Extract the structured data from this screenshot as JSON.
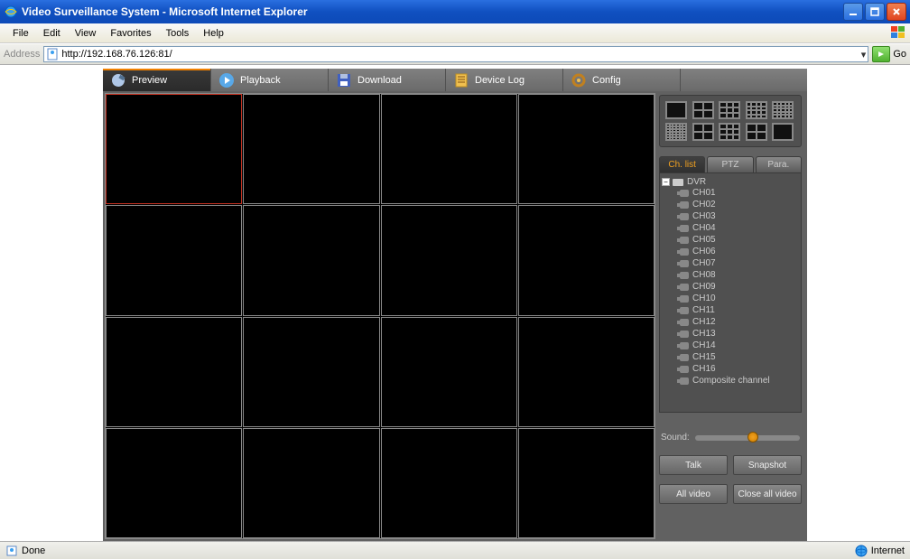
{
  "window": {
    "title": "Video Surveillance System - Microsoft Internet Explorer"
  },
  "menubar": [
    "File",
    "Edit",
    "View",
    "Favorites",
    "Tools",
    "Help"
  ],
  "addressbar": {
    "label": "Address",
    "url": "http://192.168.76.126:81/",
    "go_label": "Go"
  },
  "app_tabs": [
    {
      "label": "Preview",
      "active": true
    },
    {
      "label": "Playback",
      "active": false
    },
    {
      "label": "Download",
      "active": false
    },
    {
      "label": "Device Log",
      "active": false
    },
    {
      "label": "Config",
      "active": false
    }
  ],
  "sub_tabs": [
    {
      "label": "Ch. list",
      "active": true
    },
    {
      "label": "PTZ",
      "active": false
    },
    {
      "label": "Para.",
      "active": false
    }
  ],
  "tree": {
    "root_label": "DVR",
    "items": [
      "CH01",
      "CH02",
      "CH03",
      "CH04",
      "CH05",
      "CH06",
      "CH07",
      "CH08",
      "CH09",
      "CH10",
      "CH11",
      "CH12",
      "CH13",
      "CH14",
      "CH15",
      "CH16",
      "Composite channel"
    ]
  },
  "sound_label": "Sound:",
  "buttons": {
    "talk": "Talk",
    "snapshot": "Snapshot",
    "all_video": "All video",
    "close_all": "Close all video"
  },
  "statusbar": {
    "left": "Done",
    "right": "Internet"
  }
}
